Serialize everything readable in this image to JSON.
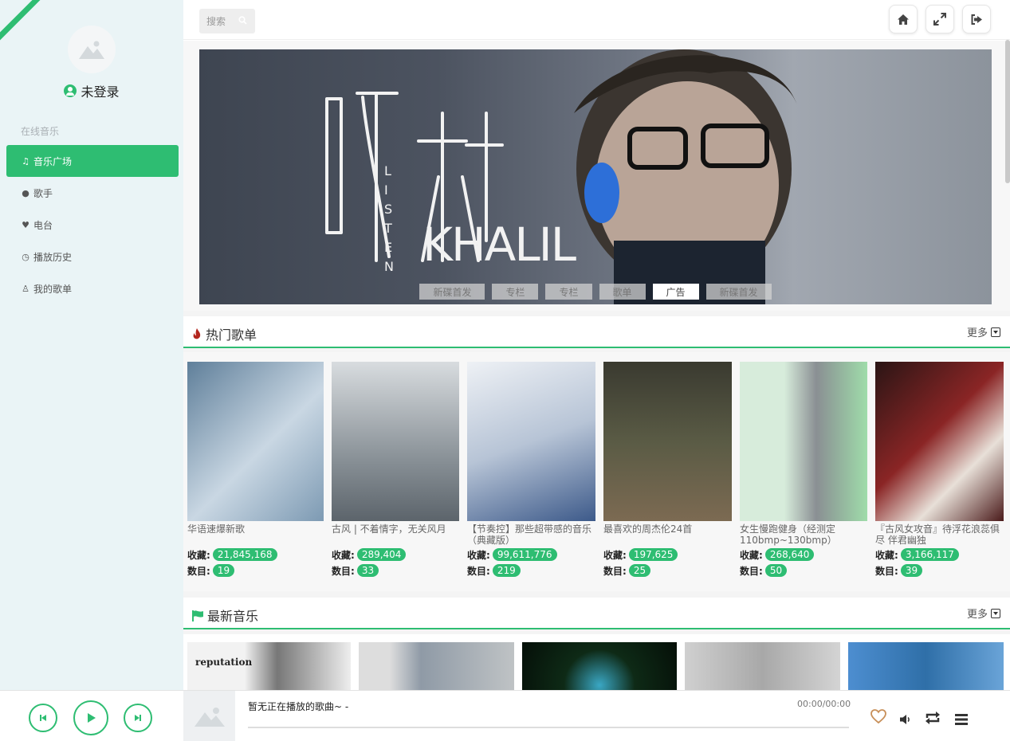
{
  "sidebar": {
    "user_label": "未登录",
    "section_label": "在线音乐",
    "items": [
      {
        "label": "音乐广场",
        "icon": "music-icon"
      },
      {
        "label": "歌手",
        "icon": "users-icon"
      },
      {
        "label": "电台",
        "icon": "heartbeat-icon"
      },
      {
        "label": "播放历史",
        "icon": "clock-icon"
      },
      {
        "label": "我的歌单",
        "icon": "user-icon"
      }
    ]
  },
  "header": {
    "search_placeholder": "搜索",
    "buttons": [
      "home-icon",
      "expand-icon",
      "sign-out-icon"
    ]
  },
  "banner": {
    "art_text": "LISTEN KHALIL",
    "tabs": [
      "新碟首发",
      "专栏",
      "专栏",
      "歌单",
      "广告",
      "新碟首发"
    ],
    "active_tab": 4
  },
  "hot": {
    "title": "热门歌单",
    "more": "更多",
    "stat_fav": "收藏:",
    "stat_count": "数目:",
    "cards": [
      {
        "title": "华语速爆新歌",
        "fav": "21,845,168",
        "count": "19",
        "color": "#7d9ab3"
      },
      {
        "title": "古风 | 不着情字，无关风月",
        "fav": "289,404",
        "count": "33",
        "color": "#8a9298"
      },
      {
        "title": "【节奏控】那些超带感的音乐（典藏版）",
        "fav": "99,611,776",
        "count": "219",
        "color": "#b7c4d6"
      },
      {
        "title": "最喜欢的周杰伦24首",
        "fav": "197,625",
        "count": "25",
        "color": "#5a5b45"
      },
      {
        "title": "女生慢跑健身（经测定110bmp~130bmp）",
        "fav": "268,640",
        "count": "50",
        "color": "#9fdcaa"
      },
      {
        "title": "『古风女攻音』待浮花浪蕊俱尽 伴君幽独",
        "fav": "3,166,117",
        "count": "39",
        "color": "#8a2525"
      }
    ]
  },
  "latest": {
    "title": "最新音乐",
    "more": "更多",
    "first_cover_text": "reputation",
    "colors": [
      "#e6e6e6",
      "#bfc3c5",
      "#0e2a16",
      "#a8a8a8",
      "#2f6fa8"
    ]
  },
  "player": {
    "now_playing": "暂无正在播放的歌曲~ -",
    "time": "00:00/00:00",
    "progress": 0,
    "heart_color": "#c8905a"
  }
}
